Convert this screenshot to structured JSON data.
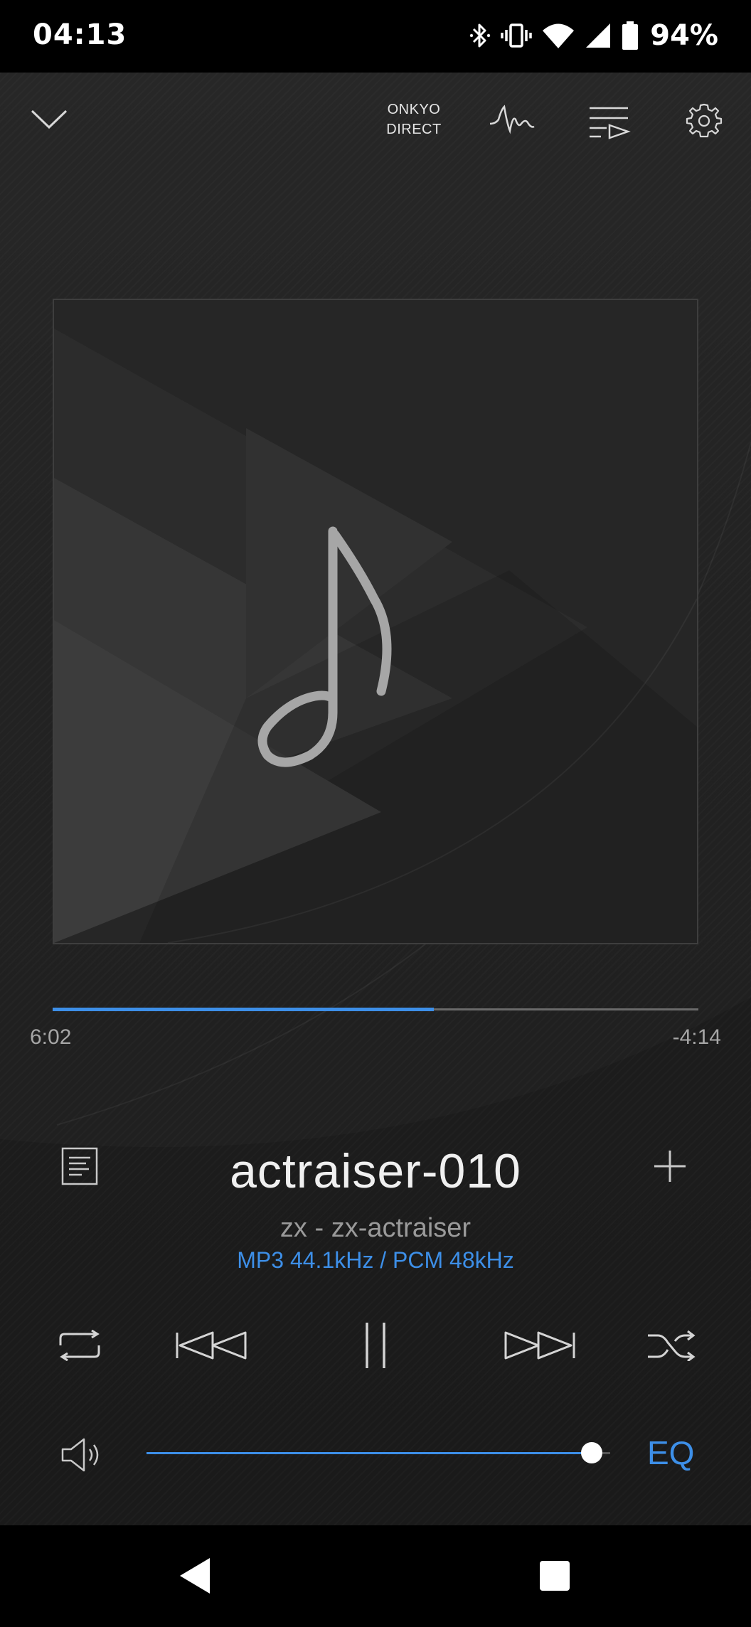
{
  "status_bar": {
    "time": "04:13",
    "battery_percent": "94%",
    "icons": [
      "bluetooth-icon",
      "vibrate-icon",
      "wifi-icon",
      "cell-signal-icon",
      "battery-icon"
    ]
  },
  "toolbar": {
    "brand_line1": "ONKYO",
    "brand_line2": "DIRECT",
    "icons": [
      "collapse-chevron-icon",
      "waveform-icon",
      "queue-icon",
      "settings-gear-icon"
    ]
  },
  "album_art": {
    "icon": "music-note-icon"
  },
  "playback": {
    "elapsed": "6:02",
    "remaining": "-4:14",
    "progress_fraction": 0.59
  },
  "track": {
    "title": "actraiser-010",
    "artist_album": "zx - zx-actraiser",
    "format": "MP3 44.1kHz / PCM 48kHz"
  },
  "controls": {
    "icons": [
      "lyrics-icon",
      "add-icon",
      "repeat-icon",
      "previous-icon",
      "pause-icon",
      "next-icon",
      "shuffle-icon"
    ]
  },
  "volume": {
    "level_fraction": 0.96,
    "eq_label": "EQ"
  },
  "nav_bar": {
    "icons": [
      "back-icon",
      "recents-icon"
    ]
  },
  "colors": {
    "accent": "#3d8fe8",
    "background": "#1d1d1d",
    "text_primary": "#f0f0f0",
    "text_secondary": "#9a9a9a"
  }
}
